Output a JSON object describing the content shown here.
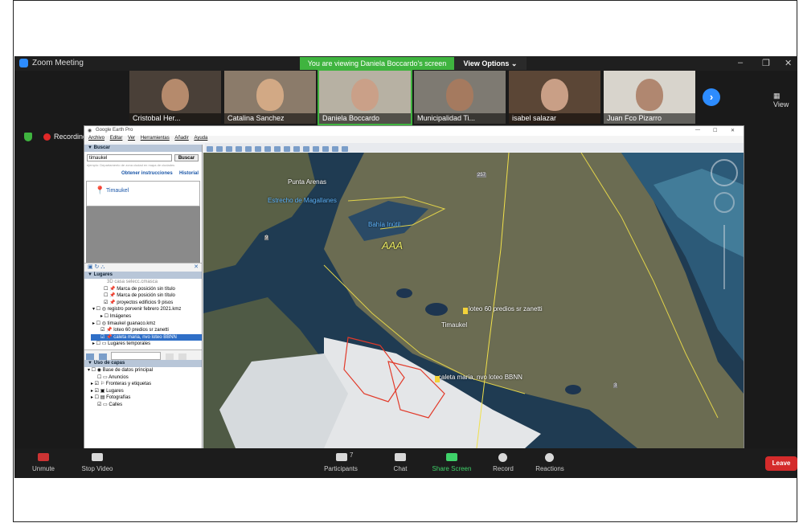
{
  "window": {
    "title": "Zoom Meeting"
  },
  "banner": {
    "text": "You are viewing Daniela Boccardo's screen",
    "view_options": "View Options ⌄"
  },
  "controls": {
    "minimize": "–",
    "restore": "❐",
    "close": "✕",
    "view_label": "▦ View"
  },
  "participants_thumbs": [
    {
      "name": "Cristobal Her...",
      "bg": "#4a4038",
      "face": "#b58a6c"
    },
    {
      "name": "Catalina Sanchez",
      "bg": "#8b7b6a",
      "face": "#d2a985"
    },
    {
      "name": "Daniela Boccardo",
      "bg": "#b7b1a3",
      "face": "#caa088"
    },
    {
      "name": "Municipalidad Ti...",
      "bg": "#7e7a72",
      "face": "#a57a5f"
    },
    {
      "name": "isabel salazar",
      "bg": "#5b4636",
      "face": "#c99f86"
    },
    {
      "name": "Juan Fco Pizarro",
      "bg": "#d8d4cc",
      "face": "#b08770"
    }
  ],
  "recording": "Recording",
  "google_earth": {
    "title": "Google Earth Pro",
    "menu": [
      "Archivo",
      "Editar",
      "Ver",
      "Herramientas",
      "Añadir",
      "Ayuda"
    ],
    "buscar_header": "▼ Buscar",
    "search_value": "timaukel",
    "search_button": "Buscar",
    "search_hint": "ejemplo: Departamento de zona ciudad en mapa de ciudades",
    "links": [
      "Obtener instrucciones",
      "Historial"
    ],
    "result": "Timaukel",
    "lugares_header": "▼ Lugares",
    "places": [
      "3D casa selecc.cmasca",
      "Marca de posición sin título",
      "Marca de posición sin título",
      "proyectos edificios 9 pisos",
      "registro porvenir febrero 2021.kmz",
      "Imágenes",
      "timaukel guanaco.kmz",
      "loteo 60 predios sr zanetti",
      "caleta maria, nvo loteo BBNN",
      "Lugares temporales"
    ],
    "capas_header": "▼ Uso de capas",
    "layers": [
      "Base de datos principal",
      "Anuncios",
      "Fronteras y etiquetas",
      "Lugares",
      "Fotografías",
      "Calles"
    ]
  },
  "map_labels": {
    "punta_arenas": "Punta Arenas",
    "estrecho": "Estrecho de Magallanes",
    "bahia": "Bahía Inútil",
    "aaa": "AAA",
    "loteo": "loteo 60 predios sr zanetti",
    "timaukel": "Timaukel",
    "caleta": "caleta maria, nvo loteo BBNN",
    "road_257": "257",
    "road_9": "9",
    "road_3": "3"
  },
  "bottom_bar": {
    "unmute": "Unmute",
    "stop_video": "Stop Video",
    "participants": "Participants",
    "participants_count": "7",
    "chat": "Chat",
    "share_screen": "Share Screen",
    "record": "Record",
    "reactions": "Reactions",
    "leave": "Leave"
  }
}
